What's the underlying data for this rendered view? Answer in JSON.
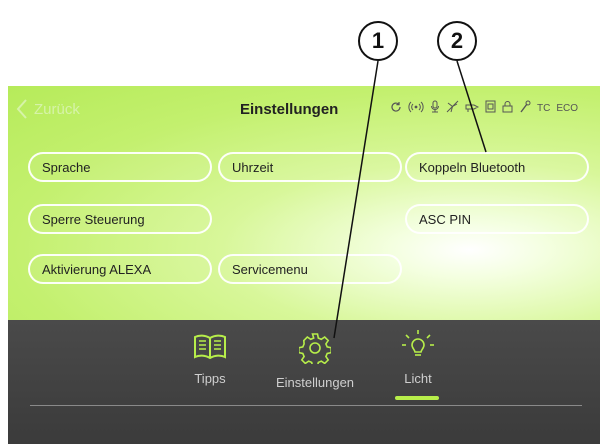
{
  "callouts": [
    "1",
    "2"
  ],
  "topbar": {
    "back_label": "Zurück",
    "title": "Einstellungen",
    "status_icons": [
      "refresh-icon",
      "signal-icon",
      "microphone-icon",
      "fan-off-icon",
      "hand-blower-icon",
      "filter-icon",
      "lock-icon",
      "wrench-icon",
      "TC",
      "ECO"
    ],
    "tc_label": "TC",
    "eco_label": "ECO"
  },
  "settings": {
    "sprache": "Sprache",
    "uhrzeit": "Uhrzeit",
    "koppeln": "Koppeln Bluetooth",
    "sperre": "Sperre Steuerung",
    "asc_pin": "ASC PIN",
    "alexa": "Aktivierung ALEXA",
    "servicemenu": "Servicemenu"
  },
  "tabs": [
    {
      "label": "Tipps",
      "icon": "book-icon"
    },
    {
      "label": "Einstellungen",
      "icon": "gear-icon"
    },
    {
      "label": "Licht",
      "icon": "lightbulb-icon",
      "active": true
    }
  ],
  "colors": {
    "green": "#c3f06e",
    "dark": "#3f3f3f",
    "accent": "#b7ee4a"
  }
}
